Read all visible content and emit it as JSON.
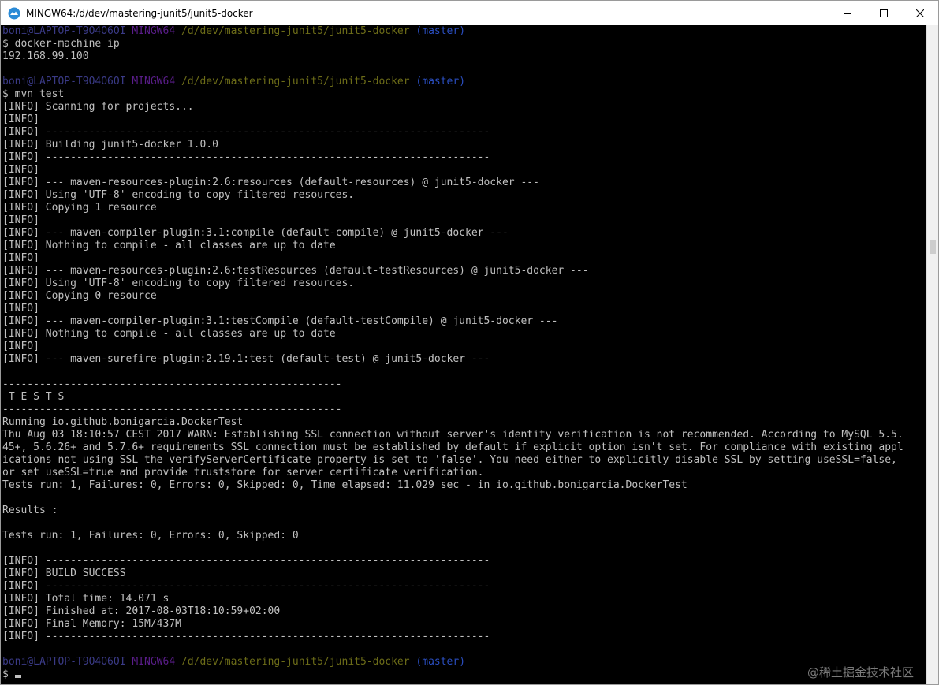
{
  "window": {
    "title": "MINGW64:/d/dev/mastering-junit5/junit5-docker"
  },
  "prompt": {
    "user_host": "boni@LAPTOP-T9O4O6OI",
    "shell": "MINGW64",
    "path": "/d/dev/mastering-junit5/junit5-docker",
    "branch": "(master)"
  },
  "terminal": {
    "lines": [
      {
        "kind": "prompt"
      },
      {
        "text": "$ docker-machine ip"
      },
      {
        "text": "192.168.99.100"
      },
      {
        "text": ""
      },
      {
        "kind": "prompt"
      },
      {
        "text": "$ mvn test"
      },
      {
        "text": "[INFO] Scanning for projects..."
      },
      {
        "text": "[INFO]"
      },
      {
        "text": "[INFO] ------------------------------------------------------------------------"
      },
      {
        "text": "[INFO] Building junit5-docker 1.0.0"
      },
      {
        "text": "[INFO] ------------------------------------------------------------------------"
      },
      {
        "text": "[INFO]"
      },
      {
        "text": "[INFO] --- maven-resources-plugin:2.6:resources (default-resources) @ junit5-docker ---"
      },
      {
        "text": "[INFO] Using 'UTF-8' encoding to copy filtered resources."
      },
      {
        "text": "[INFO] Copying 1 resource"
      },
      {
        "text": "[INFO]"
      },
      {
        "text": "[INFO] --- maven-compiler-plugin:3.1:compile (default-compile) @ junit5-docker ---"
      },
      {
        "text": "[INFO] Nothing to compile - all classes are up to date"
      },
      {
        "text": "[INFO]"
      },
      {
        "text": "[INFO] --- maven-resources-plugin:2.6:testResources (default-testResources) @ junit5-docker ---"
      },
      {
        "text": "[INFO] Using 'UTF-8' encoding to copy filtered resources."
      },
      {
        "text": "[INFO] Copying 0 resource"
      },
      {
        "text": "[INFO]"
      },
      {
        "text": "[INFO] --- maven-compiler-plugin:3.1:testCompile (default-testCompile) @ junit5-docker ---"
      },
      {
        "text": "[INFO] Nothing to compile - all classes are up to date"
      },
      {
        "text": "[INFO]"
      },
      {
        "text": "[INFO] --- maven-surefire-plugin:2.19.1:test (default-test) @ junit5-docker ---"
      },
      {
        "text": ""
      },
      {
        "text": "-------------------------------------------------------"
      },
      {
        "text": " T E S T S"
      },
      {
        "text": "-------------------------------------------------------"
      },
      {
        "text": "Running io.github.bonigarcia.DockerTest"
      },
      {
        "text": "Thu Aug 03 18:10:57 CEST 2017 WARN: Establishing SSL connection without server's identity verification is not recommended. According to MySQL 5.5."
      },
      {
        "text": "45+, 5.6.26+ and 5.7.6+ requirements SSL connection must be established by default if explicit option isn't set. For compliance with existing appl"
      },
      {
        "text": "ications not using SSL the verifyServerCertificate property is set to 'false'. You need either to explicitly disable SSL by setting useSSL=false,"
      },
      {
        "text": "or set useSSL=true and provide truststore for server certificate verification."
      },
      {
        "text": "Tests run: 1, Failures: 0, Errors: 0, Skipped: 0, Time elapsed: 11.029 sec - in io.github.bonigarcia.DockerTest"
      },
      {
        "text": ""
      },
      {
        "text": "Results :"
      },
      {
        "text": ""
      },
      {
        "text": "Tests run: 1, Failures: 0, Errors: 0, Skipped: 0"
      },
      {
        "text": ""
      },
      {
        "text": "[INFO] ------------------------------------------------------------------------"
      },
      {
        "text": "[INFO] BUILD SUCCESS"
      },
      {
        "text": "[INFO] ------------------------------------------------------------------------"
      },
      {
        "text": "[INFO] Total time: 14.071 s"
      },
      {
        "text": "[INFO] Finished at: 2017-08-03T18:10:59+02:00"
      },
      {
        "text": "[INFO] Final Memory: 15M/437M"
      },
      {
        "text": "[INFO] ------------------------------------------------------------------------"
      },
      {
        "text": ""
      },
      {
        "kind": "prompt"
      },
      {
        "kind": "input",
        "text": "$ "
      }
    ]
  },
  "watermark": "@稀土掘金技术社区",
  "icons": {
    "app": "mingw-app-icon",
    "minimize": "minimize-icon",
    "maximize": "maximize-icon",
    "close": "close-icon"
  },
  "colors": {
    "terminal_bg": "#000000",
    "terminal_fg": "#c0c0c0",
    "prompt_user": "#3a3a86",
    "prompt_shell": "#5a1d8a",
    "prompt_path": "#6c6c18",
    "prompt_branch": "#2a4ec0"
  }
}
